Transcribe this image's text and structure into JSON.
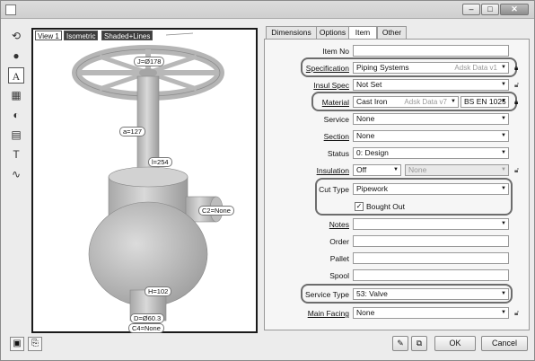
{
  "viewport": {
    "tabs": [
      "View 1",
      "Isometric",
      "Shaded+Lines"
    ],
    "dimensions": {
      "handwheel": "J=Ø178",
      "height_a": "a=127",
      "length_l": "l=254",
      "connection2": "C2=None",
      "height_h": "H=102",
      "diameter_d": "D=Ø60.3",
      "connection4": "C4=None"
    }
  },
  "tabs": [
    "Dimensions",
    "Options",
    "Item",
    "Other"
  ],
  "active_tab": "Item",
  "form": {
    "item_no": {
      "label": "Item No",
      "value": ""
    },
    "specification": {
      "label": "Specification",
      "value": "Piping Systems",
      "hint": "Adsk Data v1"
    },
    "insul_spec": {
      "label": "Insul Spec",
      "value": "Not Set"
    },
    "material": {
      "label": "Material",
      "value": "Cast Iron",
      "hint": "Adsk Data v7",
      "standard": "BS EN 1025"
    },
    "service": {
      "label": "Service",
      "value": "None"
    },
    "section": {
      "label": "Section",
      "value": "None"
    },
    "status": {
      "label": "Status",
      "value": "0: Design"
    },
    "insulation": {
      "label": "Insulation",
      "value": "Off",
      "value2": "None"
    },
    "cut_type": {
      "label": "Cut Type",
      "value": "Pipework"
    },
    "bought_out": {
      "label": "Bought Out",
      "checked": true
    },
    "notes": {
      "label": "Notes",
      "value": ""
    },
    "order": {
      "label": "Order",
      "value": ""
    },
    "pallet": {
      "label": "Pallet",
      "value": ""
    },
    "spool": {
      "label": "Spool",
      "value": ""
    },
    "service_type": {
      "label": "Service Type",
      "value": "53: Valve"
    },
    "main_facing": {
      "label": "Main Facing",
      "value": "None"
    }
  },
  "buttons": {
    "ok": "OK",
    "cancel": "Cancel"
  },
  "icons": {
    "toolbar": [
      "rotate-icon",
      "sphere-icon",
      "text-icon",
      "properties-icon",
      "fitting-icon",
      "table-icon",
      "paint-icon",
      "curve-icon"
    ],
    "bottom": [
      "snapshot-icon",
      "export-icon"
    ],
    "footer": [
      "pencil-icon",
      "link-icon"
    ]
  },
  "colors": {
    "highlight": "#6d6d6d",
    "model": "#c8c8c8"
  }
}
